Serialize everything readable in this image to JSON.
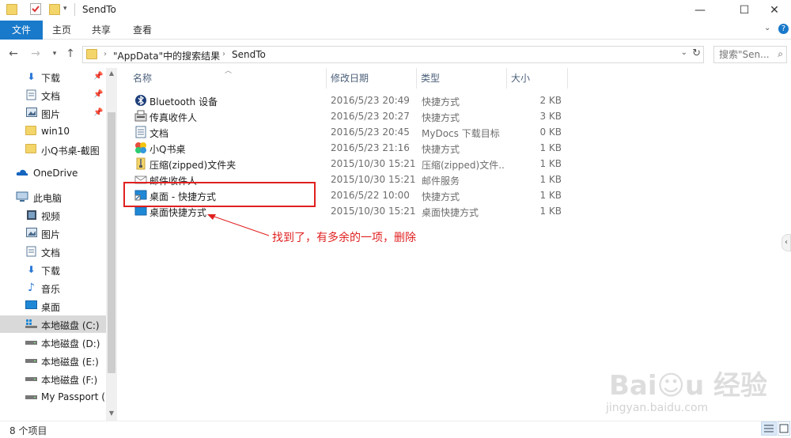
{
  "window": {
    "title": "SendTo"
  },
  "ribbon": {
    "tabs": [
      "文件",
      "主页",
      "共享",
      "查看"
    ]
  },
  "address": {
    "crumbs": [
      "\"AppData\"中的搜索结果",
      "SendTo"
    ],
    "search_placeholder": "搜索\"Sen..."
  },
  "nav": {
    "items": [
      {
        "label": "下载",
        "icon": "download-arrow-icon",
        "pinned": true
      },
      {
        "label": "文档",
        "icon": "document-icon",
        "pinned": true
      },
      {
        "label": "图片",
        "icon": "pictures-icon",
        "pinned": true
      },
      {
        "label": "win10",
        "icon": "folder-icon",
        "pinned": false
      },
      {
        "label": "小Q书桌-截图",
        "icon": "folder-icon",
        "pinned": false
      },
      {
        "label": "OneDrive",
        "icon": "onedrive-cloud-icon",
        "pinned": false
      },
      {
        "label": "此电脑",
        "icon": "pc-icon",
        "pinned": false
      },
      {
        "label": "视频",
        "icon": "video-icon",
        "pinned": false
      },
      {
        "label": "图片",
        "icon": "pictures-icon",
        "pinned": false
      },
      {
        "label": "文档",
        "icon": "document-icon",
        "pinned": false
      },
      {
        "label": "下载",
        "icon": "download-arrow-icon",
        "pinned": false
      },
      {
        "label": "音乐",
        "icon": "music-icon",
        "pinned": false
      },
      {
        "label": "桌面",
        "icon": "desktop-icon",
        "pinned": false
      },
      {
        "label": "本地磁盘 (C:)",
        "icon": "windows-drive-icon",
        "pinned": false
      },
      {
        "label": "本地磁盘 (D:)",
        "icon": "drive-icon",
        "pinned": false
      },
      {
        "label": "本地磁盘 (E:)",
        "icon": "drive-icon",
        "pinned": false
      },
      {
        "label": "本地磁盘 (F:)",
        "icon": "drive-icon",
        "pinned": false
      },
      {
        "label": "My Passport (H",
        "icon": "drive-icon",
        "pinned": false
      }
    ],
    "selected_index": 13
  },
  "columns": [
    "名称",
    "修改日期",
    "类型",
    "大小"
  ],
  "files": [
    {
      "name": "Bluetooth 设备",
      "date": "2016/5/23 20:49",
      "type": "快捷方式",
      "size": "2 KB",
      "icon": "bluetooth-icon"
    },
    {
      "name": "传真收件人",
      "date": "2016/5/23 20:27",
      "type": "快捷方式",
      "size": "3 KB",
      "icon": "fax-icon"
    },
    {
      "name": "文档",
      "date": "2016/5/23 20:45",
      "type": "MyDocs 下载目标",
      "size": "0 KB",
      "icon": "document-icon"
    },
    {
      "name": "小Q书桌",
      "date": "2016/5/23 21:16",
      "type": "快捷方式",
      "size": "1 KB",
      "icon": "xiaoq-icon"
    },
    {
      "name": "压缩(zipped)文件夹",
      "date": "2015/10/30 15:21",
      "type": "压缩(zipped)文件...",
      "size": "1 KB",
      "icon": "zip-folder-icon"
    },
    {
      "name": "邮件收件人",
      "date": "2015/10/30 15:21",
      "type": "邮件服务",
      "size": "1 KB",
      "icon": "mail-icon"
    },
    {
      "name": "桌面 - 快捷方式",
      "date": "2016/5/22 10:00",
      "type": "快捷方式",
      "size": "1 KB",
      "icon": "desktop-shortcut-icon"
    },
    {
      "name": "桌面快捷方式",
      "date": "2015/10/30 15:21",
      "type": "桌面快捷方式",
      "size": "1 KB",
      "icon": "desktop-icon"
    }
  ],
  "annotation": {
    "text": "找到了，有多余的一项，删除",
    "color": "#e02020"
  },
  "status": {
    "count": "8 个项目"
  },
  "colors": {
    "accent": "#1979ca"
  }
}
